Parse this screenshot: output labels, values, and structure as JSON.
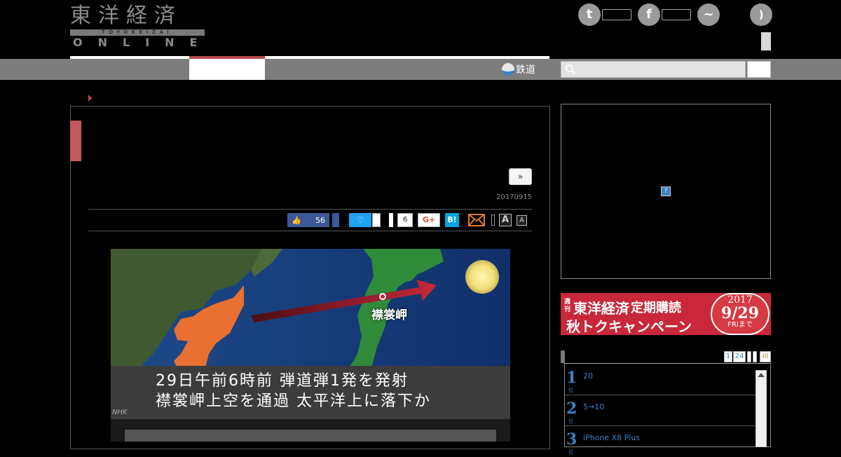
{
  "header": {
    "logo": {
      "kanji": "東洋経済",
      "roman": "TOYOKEIZAI",
      "online": "ONLINE"
    },
    "social_icons": [
      {
        "icon": "twitter-icon",
        "glyph": "t"
      },
      {
        "icon": "facebook-icon",
        "glyph": "f"
      },
      {
        "icon": "messenger-icon",
        "glyph": "~"
      },
      {
        "icon": "rss-icon",
        "glyph": ")"
      }
    ]
  },
  "nav": {
    "rail_label": "鉄道",
    "search": {
      "placeholder": ""
    }
  },
  "article": {
    "next_label": "»",
    "date": "20170915",
    "share": {
      "facebook_count": "56",
      "pocket_count": "6",
      "gplus_label": "G+",
      "hatena_label": "B!",
      "font_large": "A",
      "font_small": "A"
    },
    "photo": {
      "place_label": "襟裳岬",
      "caption_line1": "29日午前6時前  弾道弾1発を発射",
      "caption_line2": "襟裳岬上空を通過  太平洋上に落下か",
      "watermark": "NHK"
    }
  },
  "sidebar": {
    "ad_marker": "?",
    "banner": {
      "small": "週刊",
      "title": "東洋経済",
      "title2": "定期購読",
      "subtitle": "秋トクキャンペーン",
      "year": "2017",
      "date": "9/29",
      "until": "FRIまで"
    },
    "ranking": {
      "tabs": [
        "1",
        "24",
        "",
        "",
        "III"
      ],
      "items": [
        {
          "rank": "1",
          "suffix": "位",
          "title": "20"
        },
        {
          "rank": "2",
          "suffix": "位",
          "title": "5→10"
        },
        {
          "rank": "3",
          "suffix": "位",
          "title": "iPhone X8 Plus"
        }
      ]
    }
  },
  "colors": {
    "background": "#000000",
    "nav_bar": "#7d7d7d",
    "accent_red": "#c0595d",
    "link_blue": "#3b82c4",
    "facebook": "#3b5998",
    "twitter": "#1da1f2",
    "hatena": "#00a4de"
  }
}
